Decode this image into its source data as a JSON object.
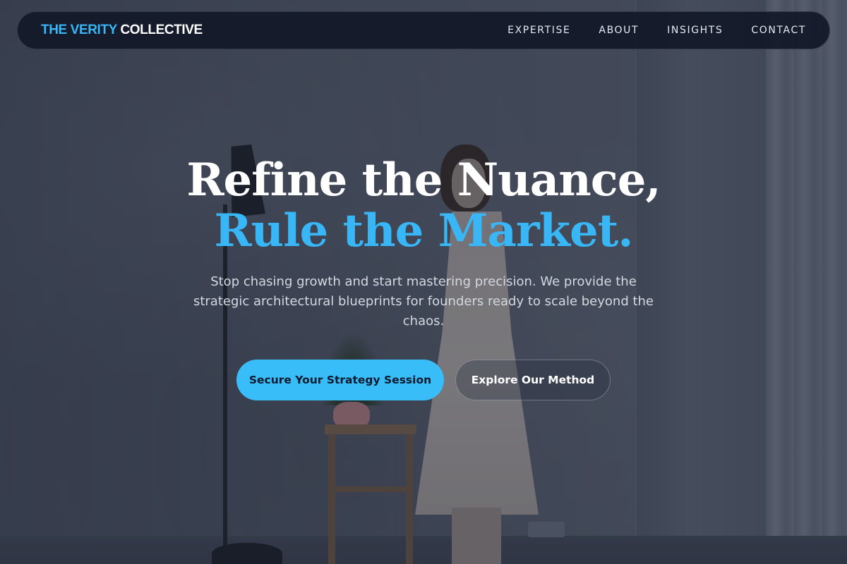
{
  "brand": {
    "accent": "THE VERITY",
    "rest": "COLLECTIVE"
  },
  "nav": {
    "items": [
      {
        "label": "EXPERTISE"
      },
      {
        "label": "ABOUT"
      },
      {
        "label": "INSIGHTS"
      },
      {
        "label": "CONTACT"
      }
    ]
  },
  "hero": {
    "headline_line1": "Refine the Nuance,",
    "headline_line2": "Rule the Market.",
    "subtext": "Stop chasing growth and start mastering precision. We provide the strategic architectural blueprints for founders ready to scale beyond the chaos.",
    "primary_cta": "Secure Your Strategy Session",
    "secondary_cta": "Explore Our Method"
  },
  "colors": {
    "accent": "#38b6f5",
    "navbar_bg": "#121828",
    "primary_button": "#38bdf8"
  }
}
